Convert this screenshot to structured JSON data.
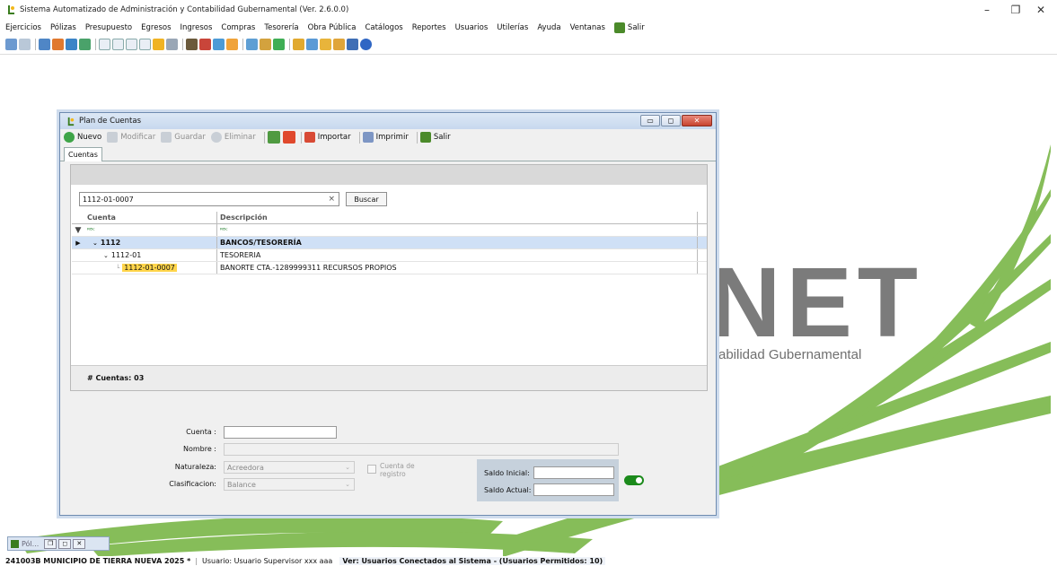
{
  "window": {
    "title": "Sistema Automatizado de Administración y Contabilidad Gubernamental (Ver. 2.6.0.0)",
    "min": "–",
    "restore": "❐",
    "close": "✕"
  },
  "menu": [
    "Ejercicios",
    "Pólizas",
    "Presupuesto",
    "Egresos",
    "Ingresos",
    "Compras",
    "Tesorería",
    "Obra Pública",
    "Catálogos",
    "Reportes",
    "Usuarios",
    "Utilerías",
    "Ayuda",
    "Ventanas",
    "Salir"
  ],
  "background": {
    "logo_text": "NET",
    "tagline": "abilidad Gubernamental",
    "accent": "#7ab648"
  },
  "plan": {
    "title": "Plan de Cuentas",
    "toolbar": {
      "nuevo": "Nuevo",
      "modificar": "Modificar",
      "guardar": "Guardar",
      "eliminar": "Eliminar",
      "importar": "Importar",
      "imprimir": "Imprimir",
      "salir": "Salir"
    },
    "tab": "Cuentas",
    "search": {
      "value": "1112-01-0007",
      "clear": "×",
      "button": "Buscar"
    },
    "grid": {
      "col_cuenta": "Cuenta",
      "col_descripcion": "Descripción",
      "filter_symbol": "ᴿᴮᶜ",
      "rows": [
        {
          "cuenta": "1112",
          "descripcion": "BANCOS/TESORERÍA"
        },
        {
          "cuenta": "1112-01",
          "descripcion": "TESORERIA"
        },
        {
          "cuenta": "1112-01-0007",
          "descripcion": "BANORTE CTA.-1289999311 RECURSOS PROPIOS"
        }
      ]
    },
    "footer": "# Cuentas: 03",
    "form": {
      "cuenta_label": "Cuenta :",
      "nombre_label": "Nombre :",
      "naturaleza_label": "Naturaleza:",
      "naturaleza_value": "Acreedora",
      "clasificacion_label": "Clasificacion:",
      "clasificacion_value": "Balance",
      "registro_label_1": "Cuenta de",
      "registro_label_2": "registro",
      "saldo_inicial_label": "Saldo Inicial:",
      "saldo_actual_label": "Saldo Actual:"
    }
  },
  "minimized": {
    "label": "Pól..."
  },
  "status": {
    "entity": "241003B MUNICIPIO DE TIERRA NUEVA  2025  *",
    "user": "Usuario: Usuario Supervisor xxx aaa",
    "connected": "Ver: Usuarios Conectados al Sistema - (Usuarios Permitidos: 10)"
  }
}
